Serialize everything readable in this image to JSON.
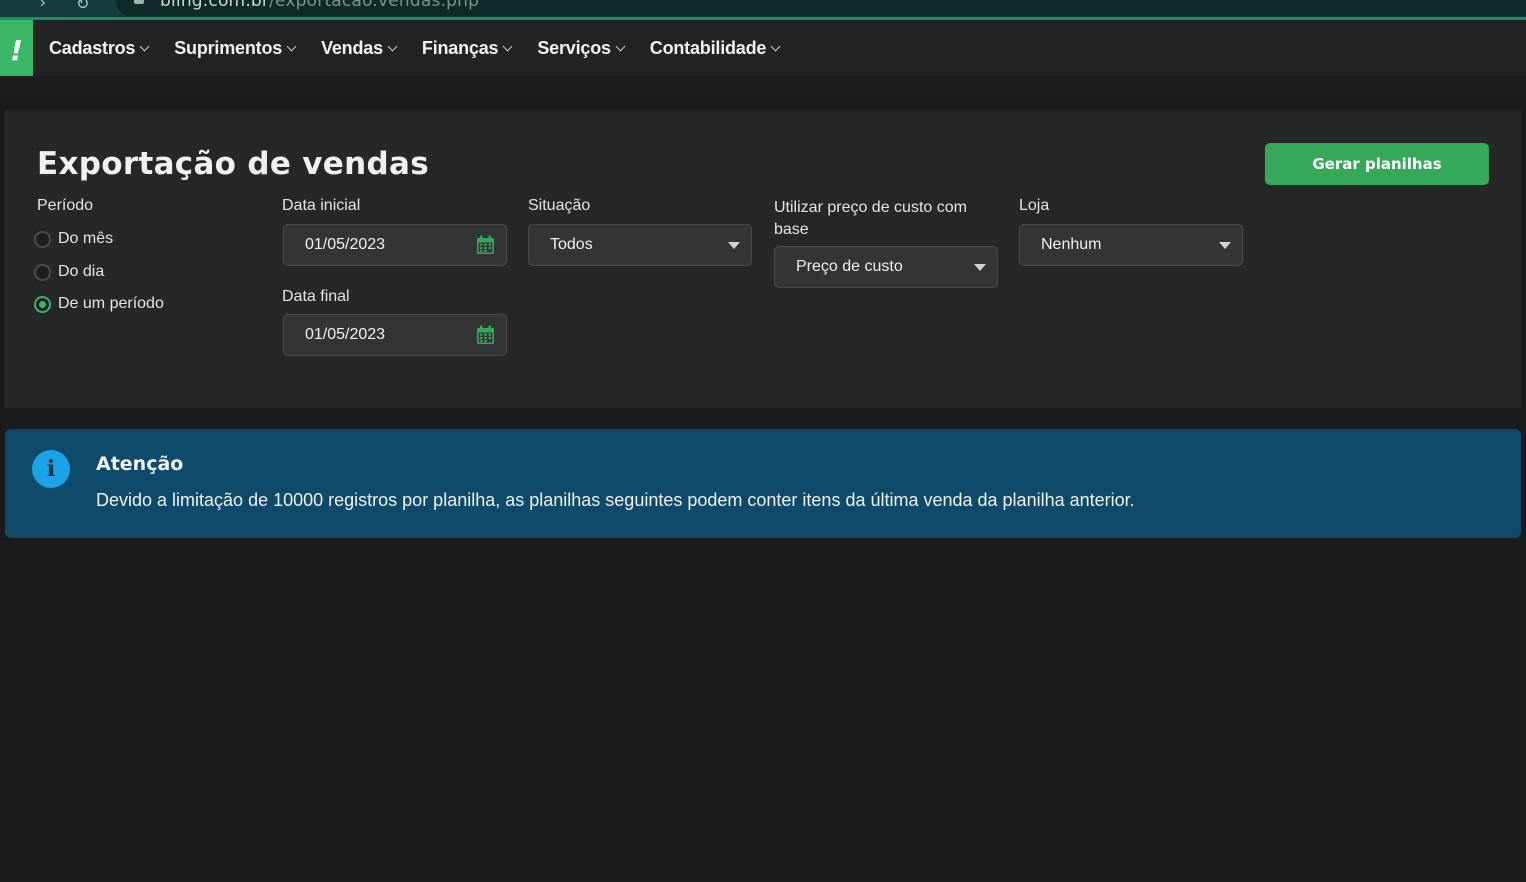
{
  "browser": {
    "url_host": "bling.com.br",
    "url_path": "/exportacao.vendas.php"
  },
  "nav": {
    "logo": "!",
    "items": [
      "Cadastros",
      "Suprimentos",
      "Vendas",
      "Finanças",
      "Serviços",
      "Contabilidade"
    ]
  },
  "page": {
    "title": "Exportação de vendas",
    "generate_button": "Gerar planilhas"
  },
  "periodo": {
    "label": "Período",
    "options": [
      "Do mês",
      "Do dia",
      "De um período"
    ],
    "selected": "De um período"
  },
  "data_inicial": {
    "label": "Data inicial",
    "value": "01/05/2023"
  },
  "data_final": {
    "label": "Data final",
    "value": "01/05/2023"
  },
  "situacao": {
    "label": "Situação",
    "value": "Todos"
  },
  "preco_custo": {
    "label_line1": "Utilizar preço de custo com",
    "label_line2": "base",
    "value": "Preço de custo"
  },
  "loja": {
    "label": "Loja",
    "value": "Nenhum"
  },
  "alert": {
    "title": "Atenção",
    "text": "Devido a limitação de 10000 registros por planilha, as planilhas seguintes podem conter itens da última venda da planilha anterior."
  },
  "colors": {
    "accent_green": "#3bb667",
    "button_green": "#35a85a",
    "alert_bg": "#0f4a6a",
    "info_icon": "#1aa3e6"
  }
}
